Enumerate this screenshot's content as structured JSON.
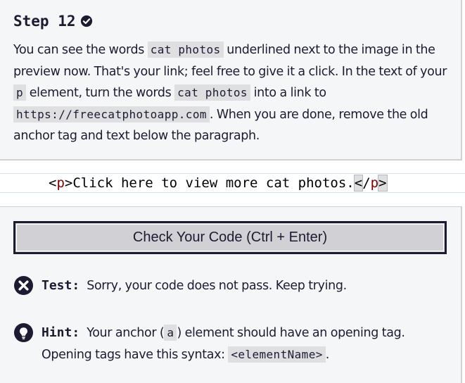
{
  "step": {
    "title": "Step 12",
    "description": {
      "t1": "You can see the words ",
      "c1": "cat photos",
      "t2": " underlined next to the image in the preview now. That's your link; feel free to give it a click. In the text of your ",
      "c2": "p",
      "t3": " element, turn the words ",
      "c3": "cat photos",
      "t4": " into a link to ",
      "c4": "https://freecatphotoapp.com",
      "t5": ". When you are done, remove the old anchor tag and text below the paragraph."
    }
  },
  "editor": {
    "line": {
      "open_lt": "<",
      "open_tag": "p",
      "open_gt": ">",
      "text": "Click here to view more cat photos.",
      "close_lt": "<",
      "close_slash": "/",
      "close_tag": "p",
      "close_gt": ">"
    }
  },
  "actions": {
    "check_button": "Check Your Code (Ctrl + Enter)"
  },
  "feedback": {
    "test_label": "Test:",
    "test_message": "Sorry, your code does not pass. Keep trying.",
    "hint_label": "Hint:",
    "hint_t1": "Your anchor (",
    "hint_c1": "a",
    "hint_t2": ") element should have an opening tag. Opening tags have this syntax: ",
    "hint_c2": "<elementName>",
    "hint_t3": "."
  },
  "icons": {
    "step_complete": "check-circle-icon",
    "test_fail": "x-circle-icon",
    "hint": "lightbulb-icon"
  }
}
